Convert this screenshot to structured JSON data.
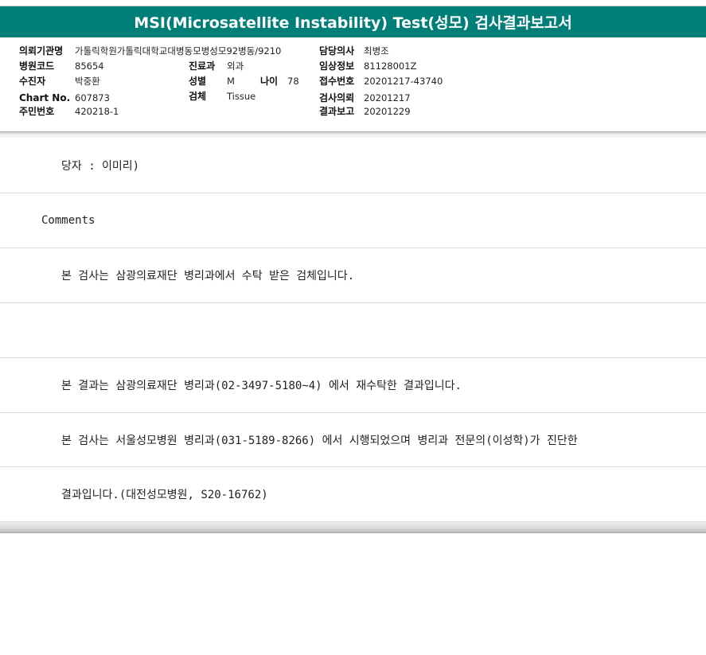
{
  "report": {
    "title": "MSI(Microsatellite Instability) Test(성모) 검사결과보고서",
    "accent_color": "#007f78"
  },
  "info": {
    "institution": {
      "label": "의뢰기관명",
      "value": "가톨릭학원가톨릭대학교대병동모병성모92병동/9210"
    },
    "hospital_code": {
      "label": "병원코드",
      "value": "85654"
    },
    "recipient": {
      "label": "수진자",
      "value": "박중환"
    },
    "chart_no": {
      "label": "Chart No.",
      "value": "607873"
    },
    "resident_no": {
      "label": "주민번호",
      "value": "420218-1"
    },
    "department": {
      "label": "진료과",
      "value": "외과"
    },
    "sex": {
      "label": "성별",
      "value": "M"
    },
    "age": {
      "label": "나이",
      "value": "78"
    },
    "specimen": {
      "label": "검체",
      "value": "Tissue"
    },
    "doctor": {
      "label": "담당의사",
      "value": "최병조"
    },
    "clinical_info": {
      "label": "임상정보",
      "value": "81128001Z"
    },
    "receipt_no": {
      "label": "접수번호",
      "value": "20201217-43740"
    },
    "request_date": {
      "label": "검사의뢰",
      "value": "20201217"
    },
    "report_date": {
      "label": "결과보고",
      "value": "20201229"
    }
  },
  "lines": [
    "당자 : 이미리)",
    "Comments",
    "본 검사는 삼광의료재단 병리과에서 수탁 받은 검체입니다.",
    "",
    "본 결과는 삼광의료재단 병리과(02-3497-5180~4) 에서 재수탁한 결과입니다.",
    "본 검사는 서울성모병원 병리과(031-5189-8266) 에서 시행되었으며 병리과 전문의(이성학)가 진단한",
    "결과입니다.(대전성모병원, S20-16762)"
  ]
}
